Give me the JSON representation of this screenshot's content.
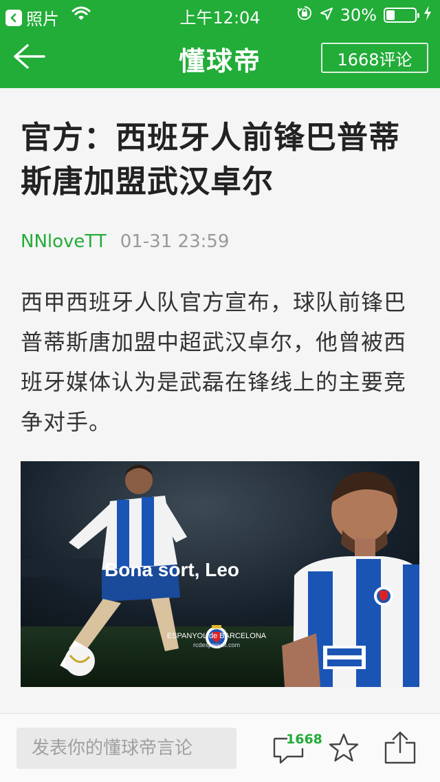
{
  "status_bar": {
    "back_app_label": "照片",
    "time": "上午12:04",
    "battery": "30%",
    "battery_level": 0.3
  },
  "header": {
    "title": "懂球帝",
    "comments_button": "1668评论"
  },
  "article": {
    "headline": "官方：西班牙人前锋巴普蒂斯唐加盟武汉卓尔",
    "author": "NNloveTT",
    "date": "01-31 23:59",
    "body": "西甲西班牙人队官方宣布，球队前锋巴普蒂斯唐加盟中超武汉卓尔，他曾被西班牙媒体认为是武磊在锋线上的主要竞争对手。"
  },
  "photo": {
    "overlay_text": "Bona sort, Leo",
    "club_name": "ESPANYOL de BARCELONA",
    "club_site": "rcdespanyol.com"
  },
  "toolbar": {
    "comment_placeholder": "发表你的懂球帝言论",
    "comment_count": "1668"
  },
  "colors": {
    "brand_green": "#22ac38",
    "author_green": "#22ac38"
  },
  "icons": [
    "back-arrow-icon",
    "wifi-icon",
    "lock-rotation-icon",
    "location-icon",
    "battery-icon",
    "charging-icon",
    "comment-bubble-icon",
    "star-icon",
    "share-icon"
  ]
}
